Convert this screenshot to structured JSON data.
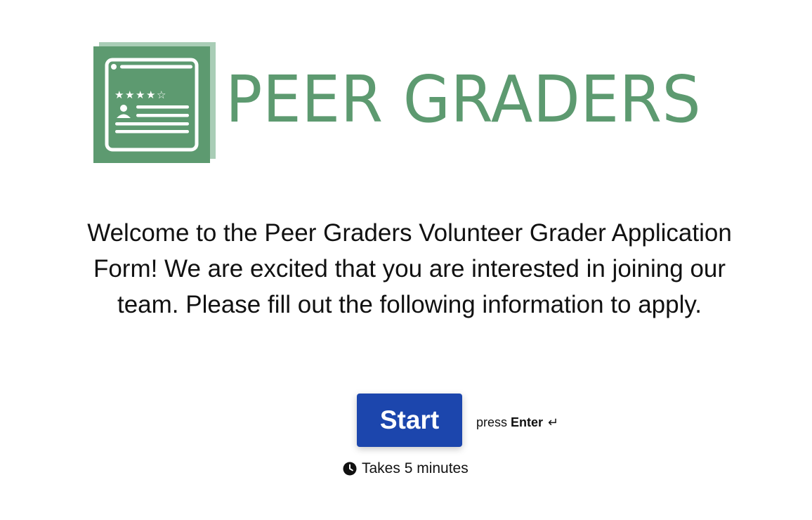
{
  "brand": {
    "name": "PEER GRADERS",
    "color": "#5d9a70",
    "logo_icon": "review-card-icon"
  },
  "welcome": {
    "message": "Welcome to the Peer Graders Volunteer Grader Application Form! We are excited that you are interested in joining our team. Please fill out the following information to apply."
  },
  "start": {
    "button_label": "Start",
    "button_color": "#1c46ad",
    "hint_prefix": "press",
    "hint_key": "Enter",
    "hint_icon": "enter-key-icon",
    "hint_symbol": "↵"
  },
  "duration": {
    "icon": "clock-icon",
    "text": "Takes 5 minutes"
  }
}
